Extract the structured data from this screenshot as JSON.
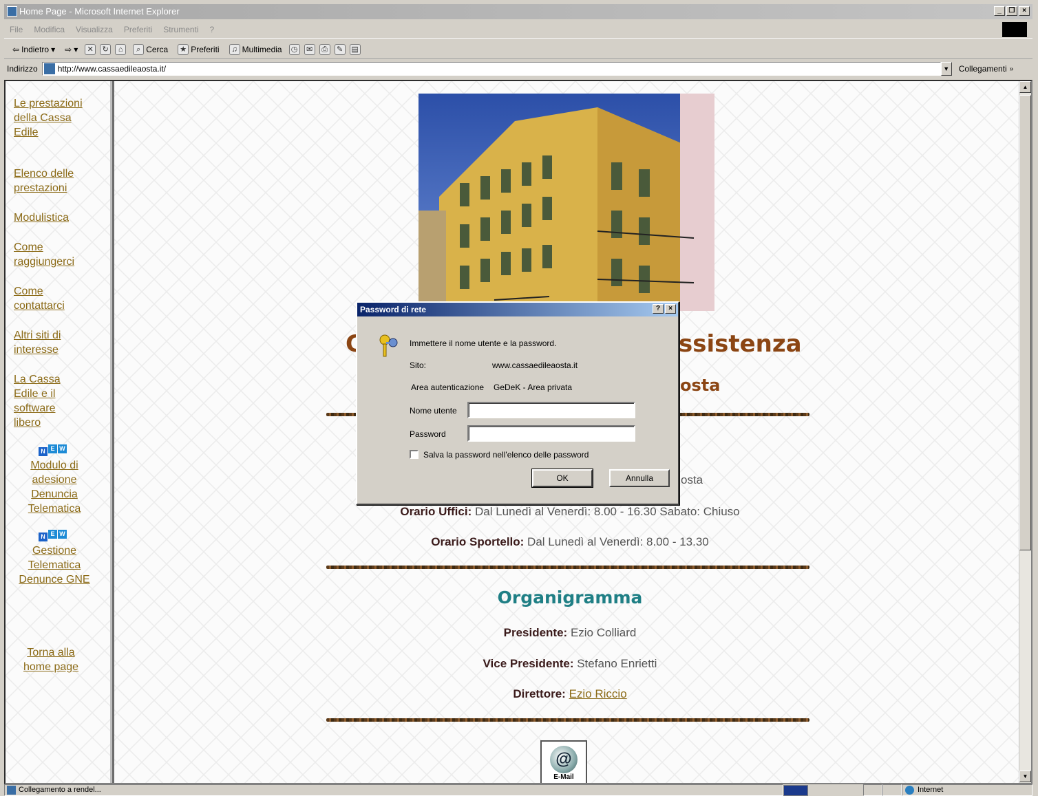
{
  "window": {
    "title": "Home Page - Microsoft Internet Explorer",
    "buttons": [
      "_",
      "\u0018",
      "×"
    ]
  },
  "menu": [
    "File",
    "Modifica",
    "Visualizza",
    "Preferiti",
    "Strumenti",
    "?"
  ],
  "toolbar": {
    "back": "Indietro",
    "search": "Cerca",
    "favorites": "Preferiti",
    "media": "Multimedia"
  },
  "address": {
    "label": "Indirizzo",
    "url": "http://www.cassaedileaosta.it/",
    "links": "Collegamenti"
  },
  "sidebar": {
    "links": [
      "Le prestazioni della Cassa Edile",
      "Elenco delle prestazioni",
      "Modulistica",
      "Come raggiungerci",
      "Come contattarci",
      "Altri siti di interesse",
      "La Cassa Edile e il software libero"
    ],
    "new_badge": "NEW",
    "new_links": [
      "Modulo di adesione Denuncia Telematica",
      "Gestione Telematica Denunce GNE"
    ],
    "home_link": "Torna alla home page"
  },
  "main": {
    "heading_left": "C",
    "heading_right": "ssistenza",
    "subheading_right": "osta",
    "address_tail": "osta",
    "office_hours_label": "Orario Uffici:",
    "office_hours_value": " Dal Lunedì al Venerdì: 8.00 - 16.30 Sabato: Chiuso",
    "desk_hours_label": "Orario Sportello:",
    "desk_hours_value": " Dal Lunedì al Venerdì: 8.00 - 13.30",
    "org_title": "Organigramma",
    "president_label": "Presidente:",
    "president_value": " Ezio Colliard",
    "vice_label": "Vice Presidente:",
    "vice_value": " Stefano Enrietti",
    "director_label": "Direttore:",
    "director_value": "Ezio Riccio",
    "email_label": "E-Mail"
  },
  "dialog": {
    "title": "Password di rete",
    "help": "?",
    "close": "×",
    "prompt": "Immettere il nome utente e la password.",
    "site_label": "Sito:",
    "site_value": "www.cassaedileaosta.it",
    "realm_label": "Area autenticazione",
    "realm_value": "GeDeK - Area privata",
    "user_label": "Nome utente",
    "user_value": "",
    "password_label": "Password",
    "password_value": "",
    "save_label": "Salva la password nell'elenco delle password",
    "ok": "OK",
    "cancel": "Annulla"
  },
  "status": {
    "text": "Collegamento a rendel...",
    "zone": "Internet"
  }
}
